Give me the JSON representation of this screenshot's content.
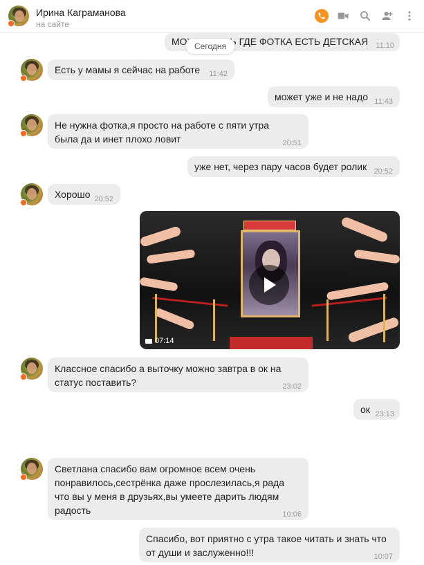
{
  "header": {
    "name": "Ирина Каграманова",
    "status": "на сайте",
    "icons": [
      "phone-icon",
      "video-camera-icon",
      "search-icon",
      "add-user-icon",
      "more-icon"
    ],
    "accent": "#f7931e"
  },
  "today_label": "Сегодня",
  "messages": [
    {
      "id": "m0",
      "side": "out",
      "text": "МОЖЕТ ЕСТЬ ГДЕ ФОТКА ЕСТЬ ДЕТСКАЯ",
      "time": "11:10"
    },
    {
      "id": "m1",
      "side": "in",
      "text": "Есть у мамы я сейчас на работе",
      "time": "11:42"
    },
    {
      "id": "m2",
      "side": "out",
      "text": "может уже и не надо",
      "time": "11:43"
    },
    {
      "id": "m3",
      "side": "in",
      "text": "Не нужна фотка,я просто на работе с пяти утра была да и инет плохо ловит",
      "time": "20:51"
    },
    {
      "id": "m4",
      "side": "out",
      "text": "уже нет, через пару часов будет ролик",
      "time": "20:52"
    },
    {
      "id": "m5",
      "side": "in",
      "text": "Хорошо",
      "time": "20:52"
    },
    {
      "id": "m6",
      "side": "out",
      "type": "video",
      "duration": "07:14"
    },
    {
      "id": "m7",
      "side": "in",
      "text": "Классное спасибо а выточку можно завтра в ок на статус поставить?",
      "time": "23:02"
    },
    {
      "id": "m8",
      "side": "out",
      "text": "ок",
      "time": "23:13"
    },
    {
      "id": "m9",
      "side": "in",
      "text": "Светлана спасибо вам огромное всем очень понравилось,сестрёнка даже прослезилась,я рада что вы у меня в друзьях,вы умеете дарить людям радость",
      "time": "10:06"
    },
    {
      "id": "m10",
      "side": "out",
      "text": "Спасибо, вот приятно с утра такое читать и знать что от души и заслуженно!!!",
      "time": "10:07"
    }
  ]
}
